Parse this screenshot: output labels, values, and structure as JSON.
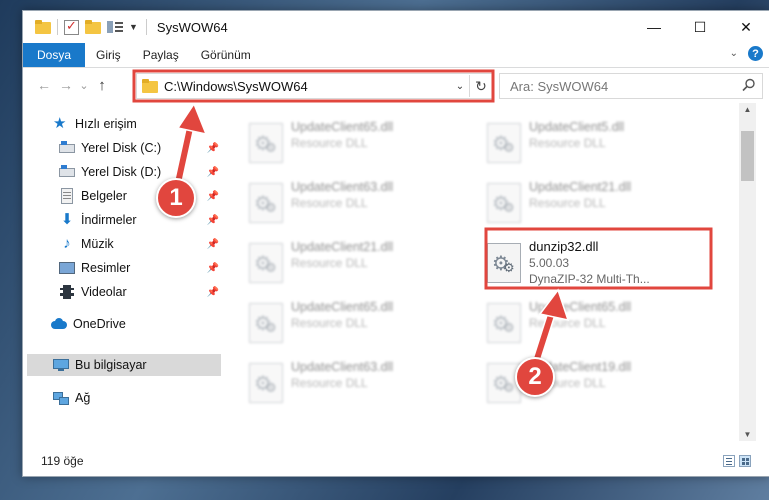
{
  "window": {
    "title": "SysWOW64",
    "controls": {
      "minimize": "—",
      "maximize": "☐",
      "close": "✕"
    }
  },
  "ribbon": {
    "tabs": [
      {
        "label": "Dosya",
        "active": true
      },
      {
        "label": "Giriş"
      },
      {
        "label": "Paylaş"
      },
      {
        "label": "Görünüm"
      }
    ],
    "help": "?"
  },
  "nav": {
    "back": "←",
    "forward": "→",
    "recent": "⌄",
    "up": "↑",
    "address": "C:\\Windows\\SysWOW64",
    "search_placeholder": "Ara: SysWOW64"
  },
  "sidebar": {
    "items": [
      {
        "label": "Hızlı erişim",
        "icon": "star-icon"
      },
      {
        "label": "Yerel Disk (C:)",
        "icon": "drive-icon",
        "pinned": true
      },
      {
        "label": "Yerel Disk (D:)",
        "icon": "drive-icon",
        "pinned": true
      },
      {
        "label": "Belgeler",
        "icon": "document-icon",
        "pinned": true
      },
      {
        "label": "İndirmeler",
        "icon": "download-icon",
        "pinned": true
      },
      {
        "label": "Müzik",
        "icon": "music-icon",
        "pinned": true
      },
      {
        "label": "Resimler",
        "icon": "pictures-icon",
        "pinned": true
      },
      {
        "label": "Videolar",
        "icon": "videos-icon",
        "pinned": true
      },
      {
        "label": "OneDrive",
        "icon": "cloud-icon"
      },
      {
        "label": "Bu bilgisayar",
        "icon": "computer-icon",
        "selected": true
      },
      {
        "label": "Ağ",
        "icon": "network-icon"
      }
    ]
  },
  "files": [
    {
      "name": "UpdateClient65.dll",
      "desc": "Resource DLL"
    },
    {
      "name": "UpdateClient5.dll",
      "desc": "Resource DLL"
    },
    {
      "name": "UpdateClient63.dll",
      "desc": "Resource DLL"
    },
    {
      "name": "UpdateClient21.dll",
      "desc": "Resource DLL"
    },
    {
      "name": "UpdateClient21.dll",
      "desc": "Resource DLL"
    },
    {
      "name": "dunzip32.dll",
      "version": "5.00.03",
      "desc": "DynaZIP-32 Multi-Th...",
      "highlighted": true
    },
    {
      "name": "UpdateClient65.dll",
      "desc": "Resource DLL"
    },
    {
      "name": "UpdateClient65.dll",
      "desc": "Resource DLL"
    },
    {
      "name": "UpdateClient63.dll",
      "desc": "Resource DLL"
    },
    {
      "name": "UpdateClient19.dll",
      "desc": "Resource DLL"
    }
  ],
  "status": {
    "count": "119 öğe"
  },
  "annotations": [
    {
      "number": "1"
    },
    {
      "number": "2"
    }
  ],
  "colors": {
    "accent": "#1979ca",
    "annotation_red": "#e1463e"
  }
}
